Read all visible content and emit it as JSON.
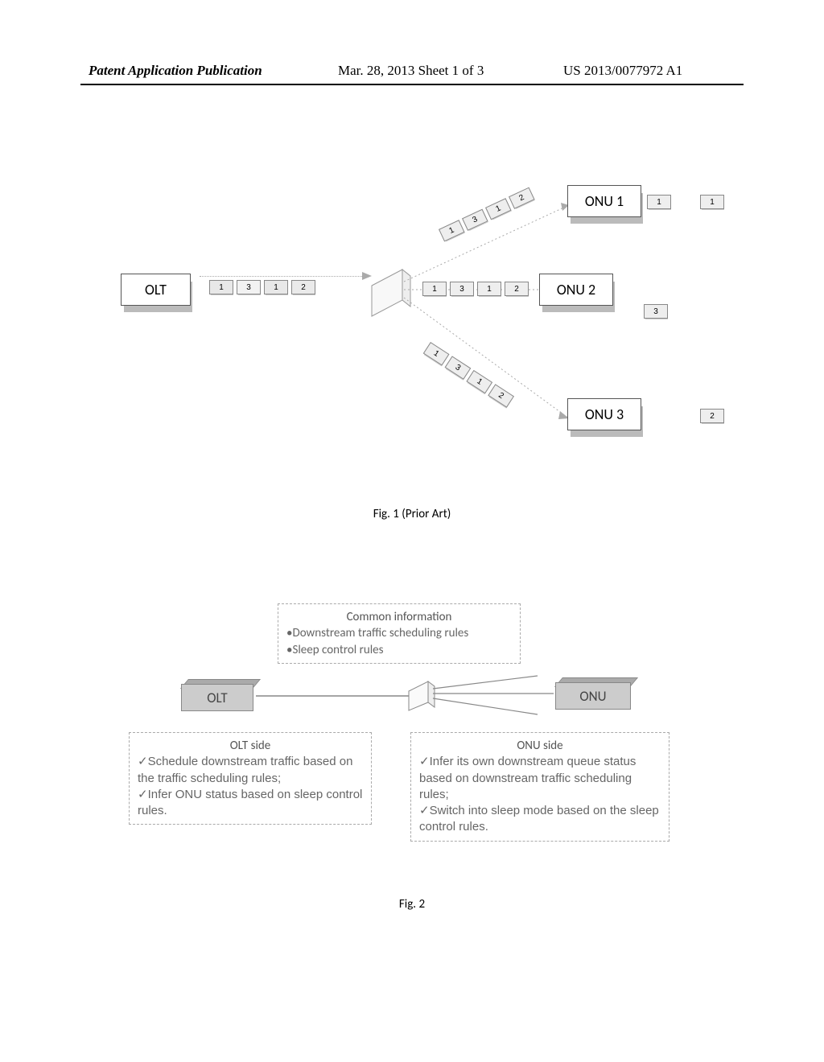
{
  "header": {
    "left": "Patent Application Publication",
    "middle": "Mar. 28, 2013  Sheet 1 of 3",
    "right": "US 2013/0077972 A1"
  },
  "fig1": {
    "olt": "OLT",
    "onu1": "ONU 1",
    "onu2": "ONU 2",
    "onu3": "ONU 3",
    "p1": "1",
    "p2": "2",
    "p3": "3",
    "caption": "Fig. 1 (Prior Art)"
  },
  "fig2": {
    "common_title": "Common information",
    "common_b1": "•Downstream traffic scheduling rules",
    "common_b2": "•Sleep control rules",
    "olt": "OLT",
    "onu": "ONU",
    "olt_side_title": "OLT side",
    "olt_side_1": "✓Schedule downstream traffic based on the traffic scheduling rules;",
    "olt_side_2": "✓Infer ONU status based on sleep control rules.",
    "onu_side_title": "ONU side",
    "onu_side_1": "✓Infer its own downstream queue status based on downstream traffic scheduling rules;",
    "onu_side_2": "✓Switch into sleep mode based on the  sleep control rules.",
    "caption": "Fig. 2"
  }
}
